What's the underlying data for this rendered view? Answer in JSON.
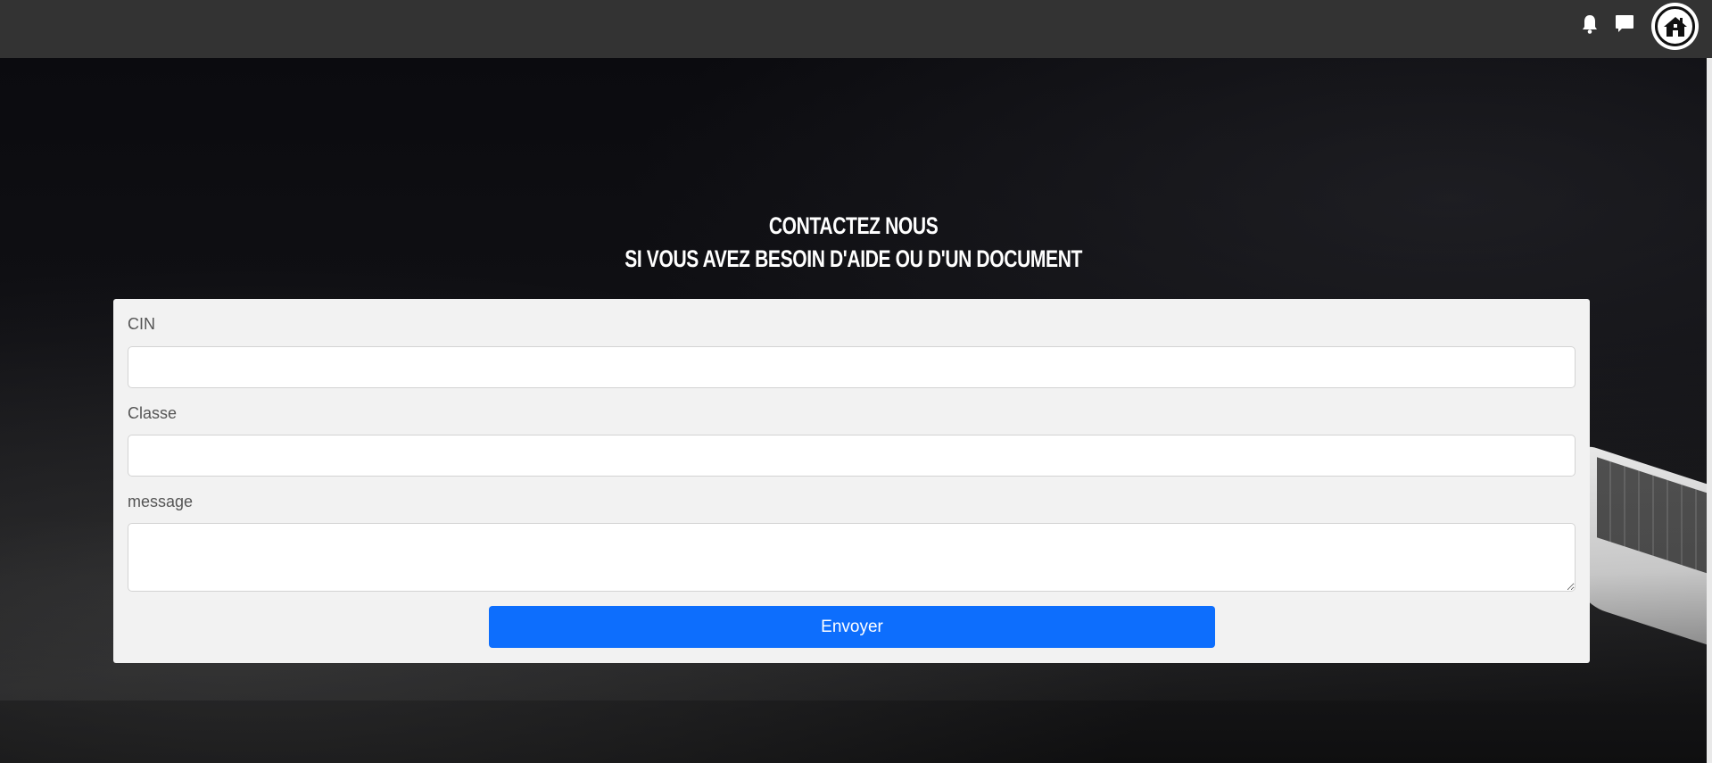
{
  "topbar": {
    "icons": [
      "bell-icon",
      "chat-icon",
      "home-icon"
    ],
    "background": "#333333"
  },
  "hero": {
    "title_line1": "CONTACTEZ NOUS",
    "title_line2": "SI VOUS AVEZ BESOIN D'AIDE OU D'UN DOCUMENT"
  },
  "form": {
    "cin_label": "CIN",
    "cin_value": "",
    "classe_label": "Classe",
    "classe_value": "",
    "message_label": "message",
    "message_value": "",
    "submit_label": "Envoyer",
    "submit_color": "#0d6efd"
  }
}
